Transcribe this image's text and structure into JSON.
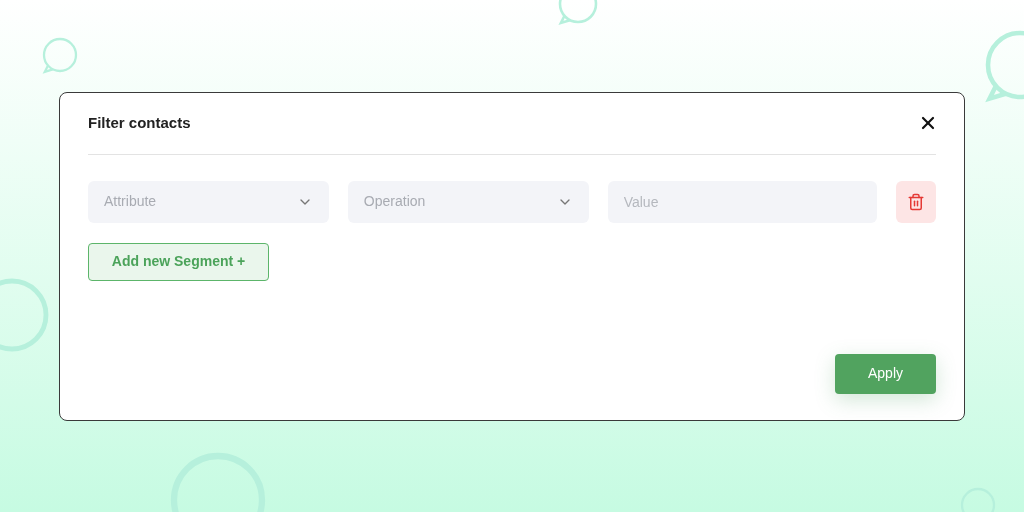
{
  "dialog": {
    "title": "Filter contacts",
    "fields": [
      {
        "kind": "select",
        "placeholder": "Attribute"
      },
      {
        "kind": "select",
        "placeholder": "Operation"
      },
      {
        "kind": "input",
        "placeholder": "Value"
      }
    ],
    "add_button": "Add new Segment +",
    "apply_button": "Apply"
  }
}
